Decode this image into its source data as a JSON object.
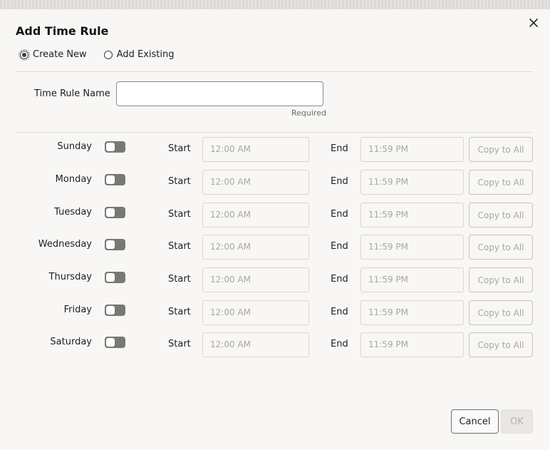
{
  "dialog": {
    "title": "Add Time Rule",
    "mode_options": [
      {
        "label": "Create New",
        "selected": true
      },
      {
        "label": "Add Existing",
        "selected": false
      }
    ],
    "name_field": {
      "label": "Time Rule Name",
      "value": "",
      "hint": "Required"
    },
    "start_label": "Start",
    "end_label": "End",
    "copy_label": "Copy to All",
    "days": [
      {
        "name": "Sunday",
        "enabled": false,
        "start": "12:00 AM",
        "end": "11:59 PM"
      },
      {
        "name": "Monday",
        "enabled": false,
        "start": "12:00 AM",
        "end": "11:59 PM"
      },
      {
        "name": "Tuesday",
        "enabled": false,
        "start": "12:00 AM",
        "end": "11:59 PM"
      },
      {
        "name": "Wednesday",
        "enabled": false,
        "start": "12:00 AM",
        "end": "11:59 PM"
      },
      {
        "name": "Thursday",
        "enabled": false,
        "start": "12:00 AM",
        "end": "11:59 PM"
      },
      {
        "name": "Friday",
        "enabled": false,
        "start": "12:00 AM",
        "end": "11:59 PM"
      },
      {
        "name": "Saturday",
        "enabled": false,
        "start": "12:00 AM",
        "end": "11:59 PM"
      }
    ],
    "buttons": {
      "cancel": "Cancel",
      "ok": "OK"
    },
    "icons": {
      "close": "close-icon"
    }
  }
}
